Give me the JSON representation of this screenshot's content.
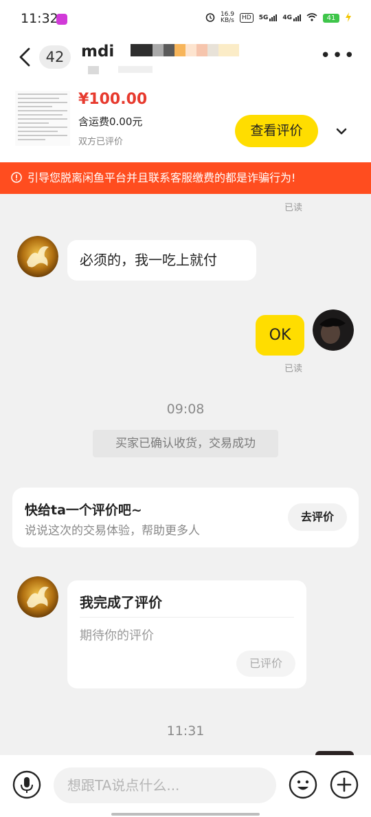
{
  "status_bar": {
    "time": "11:32",
    "speed_value": "16.9",
    "speed_unit": "KB/s",
    "hd_label": "HD",
    "net1": "5G",
    "net2": "4G",
    "battery": "41"
  },
  "header": {
    "unread_count": "42",
    "contact_name": "mdi",
    "more_label": "•••"
  },
  "product": {
    "price": "¥100.00",
    "shipping": "含运费0.00元",
    "status": "双方已评价",
    "review_button": "查看评价"
  },
  "warning": {
    "text": "引导您脱离闲鱼平台并且联系客服缴费的都是诈骗行为!"
  },
  "messages": {
    "read_top": "已读",
    "msg1": "必须的，我一吃上就付",
    "msg2": "OK",
    "read_ok": "已读",
    "time1": "09:08",
    "system_notice": "买家已确认收货，交易成功",
    "time2": "11:31"
  },
  "review_prompt": {
    "title": "快给ta一个评价吧~",
    "subtitle": "说说这次的交易体验，帮助更多人",
    "button": "去评价"
  },
  "review_card": {
    "title": "我完成了评价",
    "placeholder": "期待你的评价",
    "button": "已评价"
  },
  "input": {
    "placeholder": "想跟TA说点什么..."
  },
  "colors": {
    "accent_yellow": "#ffdd00",
    "warning_red": "#ff4d1f",
    "price_red": "#e73b2f"
  },
  "icons": [
    "back-arrow-icon",
    "more-icon",
    "chevron-down-icon",
    "warning-icon",
    "voice-icon",
    "emoji-icon",
    "plus-icon"
  ]
}
